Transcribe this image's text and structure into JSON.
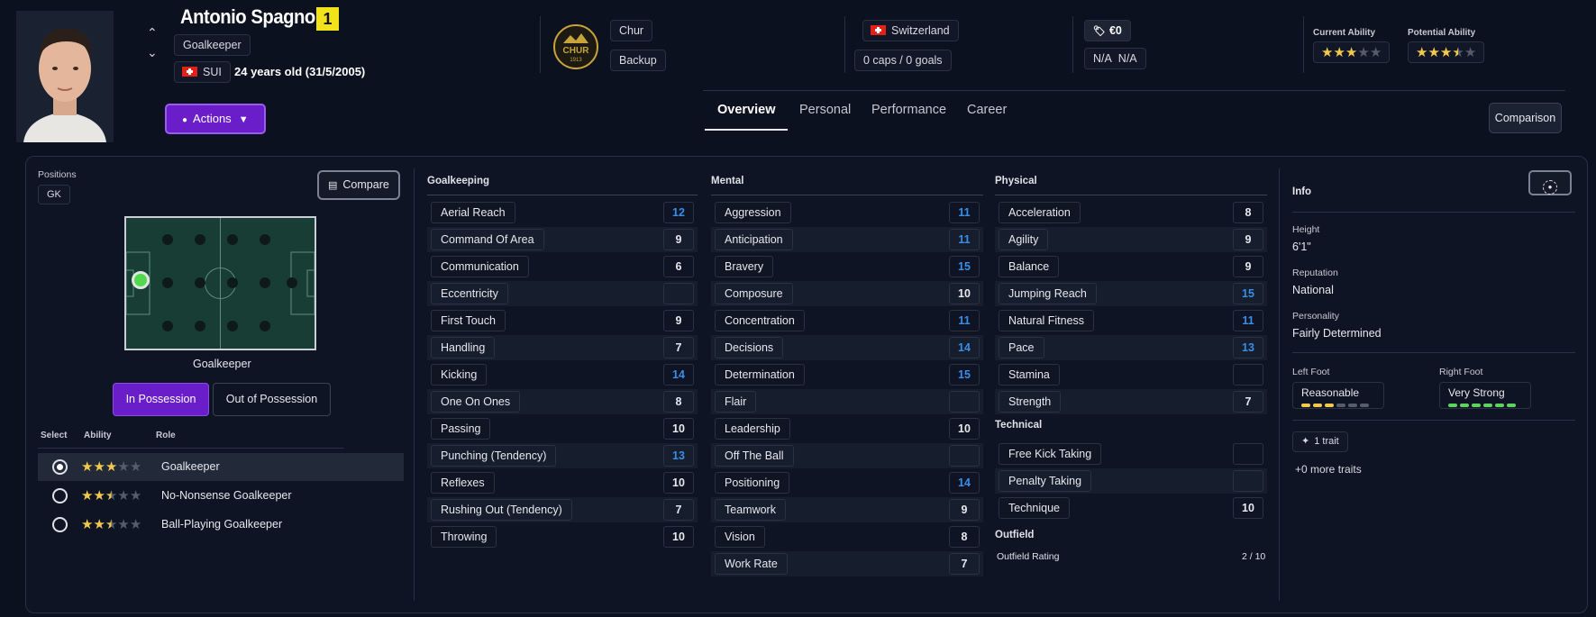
{
  "player": {
    "name": "Antonio Spagnoli",
    "shirt_number": "1",
    "position": "Goalkeeper",
    "nationality_code": "SUI",
    "age_text": "24 years old (31/5/2005)"
  },
  "club": {
    "logo_text": "CHUR",
    "logo_year": "1913",
    "name": "Chur",
    "squad_status": "Backup"
  },
  "nation": {
    "name": "Switzerland",
    "caps_goals": "0 caps / 0 goals"
  },
  "value": {
    "amount": "€0",
    "wage_a": "N/A",
    "wage_b": "N/A"
  },
  "ability": {
    "current_label": "Current Ability",
    "current_stars": 3,
    "potential_label": "Potential Ability",
    "potential_stars": 3.5
  },
  "actions_label": "Actions",
  "tabs": [
    {
      "label": "Overview",
      "active": true
    },
    {
      "label": "Personal",
      "active": false
    },
    {
      "label": "Performance",
      "active": false
    },
    {
      "label": "Career",
      "active": false
    }
  ],
  "comparison_label": "Comparison",
  "positions": {
    "label": "Positions",
    "chip": "GK",
    "compare_label": "Compare",
    "pitch_label": "Goalkeeper",
    "in_possession": "In Possession",
    "out_of_possession": "Out of Possession"
  },
  "roles": {
    "headers": {
      "select": "Select",
      "ability": "Ability",
      "role": "Role"
    },
    "items": [
      {
        "name": "Goalkeeper",
        "stars": 3,
        "selected": true
      },
      {
        "name": "No-Nonsense Goalkeeper",
        "stars": 2.5,
        "selected": false
      },
      {
        "name": "Ball-Playing Goalkeeper",
        "stars": 2.5,
        "selected": false
      }
    ]
  },
  "goalkeeping": {
    "title": "Goalkeeping",
    "items": [
      {
        "name": "Aerial Reach",
        "value": "12"
      },
      {
        "name": "Command Of Area",
        "value": "9"
      },
      {
        "name": "Communication",
        "value": "6"
      },
      {
        "name": "Eccentricity",
        "value": ""
      },
      {
        "name": "First Touch",
        "value": "9"
      },
      {
        "name": "Handling",
        "value": "7"
      },
      {
        "name": "Kicking",
        "value": "14"
      },
      {
        "name": "One On Ones",
        "value": "8"
      },
      {
        "name": "Passing",
        "value": "10"
      },
      {
        "name": "Punching (Tendency)",
        "value": "13"
      },
      {
        "name": "Reflexes",
        "value": "10"
      },
      {
        "name": "Rushing Out (Tendency)",
        "value": "7"
      },
      {
        "name": "Throwing",
        "value": "10"
      }
    ]
  },
  "mental": {
    "title": "Mental",
    "items": [
      {
        "name": "Aggression",
        "value": "11"
      },
      {
        "name": "Anticipation",
        "value": "11"
      },
      {
        "name": "Bravery",
        "value": "15"
      },
      {
        "name": "Composure",
        "value": "10"
      },
      {
        "name": "Concentration",
        "value": "11"
      },
      {
        "name": "Decisions",
        "value": "14"
      },
      {
        "name": "Determination",
        "value": "15"
      },
      {
        "name": "Flair",
        "value": ""
      },
      {
        "name": "Leadership",
        "value": "10"
      },
      {
        "name": "Off The Ball",
        "value": ""
      },
      {
        "name": "Positioning",
        "value": "14"
      },
      {
        "name": "Teamwork",
        "value": "9"
      },
      {
        "name": "Vision",
        "value": "8"
      },
      {
        "name": "Work Rate",
        "value": "7"
      }
    ]
  },
  "physical": {
    "title": "Physical",
    "items": [
      {
        "name": "Acceleration",
        "value": "8"
      },
      {
        "name": "Agility",
        "value": "9"
      },
      {
        "name": "Balance",
        "value": "9"
      },
      {
        "name": "Jumping Reach",
        "value": "15"
      },
      {
        "name": "Natural Fitness",
        "value": "11"
      },
      {
        "name": "Pace",
        "value": "13"
      },
      {
        "name": "Stamina",
        "value": ""
      },
      {
        "name": "Strength",
        "value": "7"
      }
    ]
  },
  "technical": {
    "title": "Technical",
    "items": [
      {
        "name": "Free Kick Taking",
        "value": ""
      },
      {
        "name": "Penalty Taking",
        "value": ""
      },
      {
        "name": "Technique",
        "value": "10"
      }
    ]
  },
  "outfield": {
    "title": "Outfield",
    "rating_label": "Outfield Rating",
    "rating_value": "2 / 10"
  },
  "info": {
    "title": "Info",
    "height_label": "Height",
    "height": "6'1\"",
    "reputation_label": "Reputation",
    "reputation": "National",
    "personality_label": "Personality",
    "personality": "Fairly Determined",
    "left_foot_label": "Left Foot",
    "left_foot": "Reasonable",
    "left_foot_level": 3,
    "right_foot_label": "Right Foot",
    "right_foot": "Very Strong",
    "right_foot_level": 6,
    "traits_label": "1 trait",
    "more_traits": "+0 more traits"
  },
  "colors": {
    "accent": "#6a1ec9",
    "high_value": "#3a8ee8",
    "star": "#f2c94c",
    "foot_reasonable": "#f2c94c",
    "foot_strong": "#5fd35f"
  }
}
